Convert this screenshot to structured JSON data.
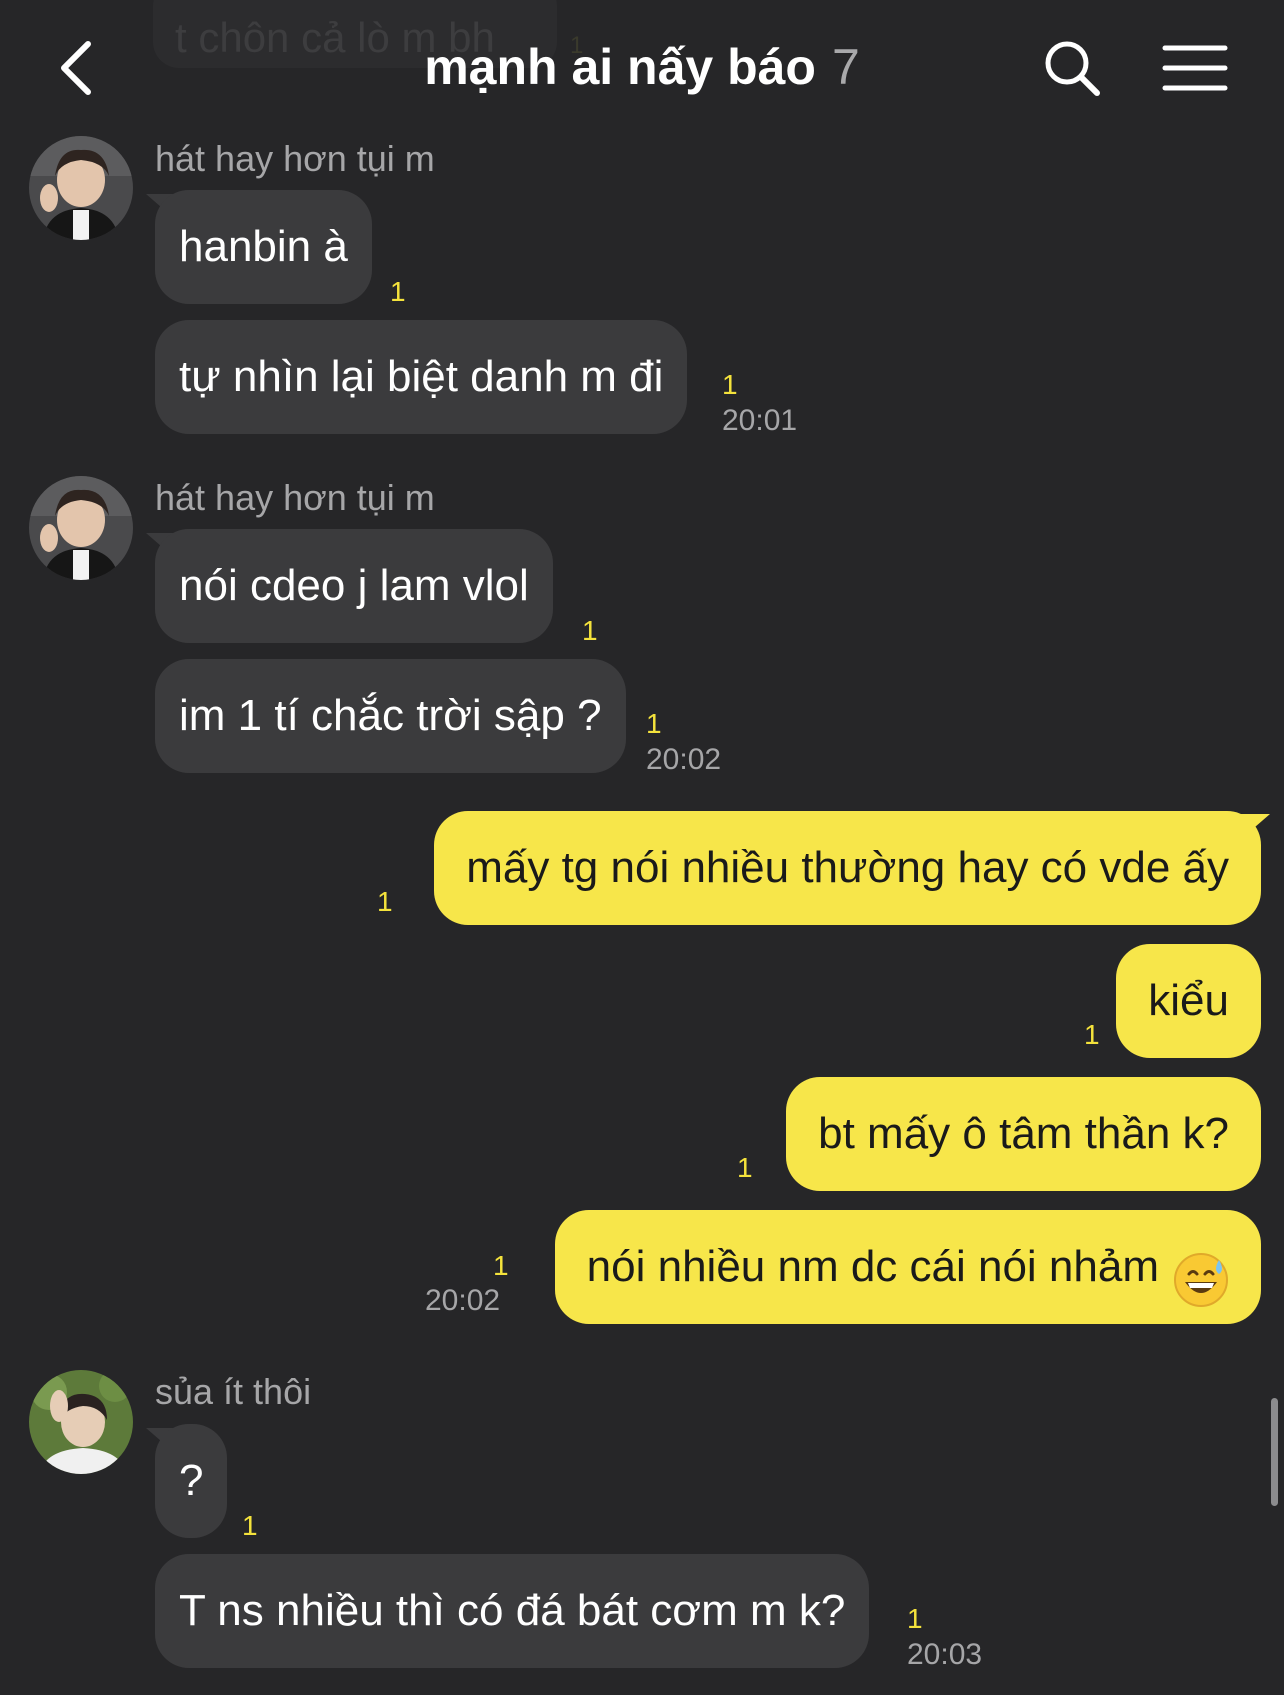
{
  "header": {
    "title": "mạnh ai nấy báo",
    "member_count": "7",
    "pinned_preview_text": "t chôn cả lò m bh",
    "pinned_preview_count": "1"
  },
  "icons": {
    "back": "chevron-left-icon",
    "search": "search-icon",
    "menu": "hamburger-menu-icon"
  },
  "colors": {
    "background": "#262628",
    "incoming_bubble": "#3b3b3d",
    "outgoing_bubble": "#f7e64a",
    "unread_count": "#f4e23c"
  },
  "messages": {
    "g1": {
      "sender": "hát hay hơn tụi m",
      "m1": {
        "text": "hanbin à",
        "unread": "1"
      },
      "m2": {
        "text": "tự nhìn lại biệt danh m đi",
        "unread": "1",
        "time": "20:01"
      }
    },
    "g2": {
      "sender": "hát hay hơn tụi m",
      "m1": {
        "text": "nói cdeo j lam vlol",
        "unread": "1"
      },
      "m2": {
        "text": "im 1 tí chắc trời sập ?",
        "unread": "1",
        "time": "20:02"
      }
    },
    "mine": {
      "m1": {
        "text": "mấy tg nói nhiều thường hay có vde ấy",
        "unread": "1"
      },
      "m2": {
        "text": "kiểu",
        "unread": "1"
      },
      "m3": {
        "text": "bt mấy ô tâm thần k?",
        "unread": "1"
      },
      "m4": {
        "text": "nói nhiều nm dc cái nói nhảm",
        "emoji": "grinning-face-with-sweat-emoji",
        "unread": "1",
        "time": "20:02"
      }
    },
    "g3": {
      "sender": "sủa ít thôi",
      "m1": {
        "text": "?",
        "unread": "1"
      },
      "m2": {
        "text": "T ns nhiều thì có đá bát cơm m k?",
        "unread": "1",
        "time": "20:03"
      }
    }
  }
}
